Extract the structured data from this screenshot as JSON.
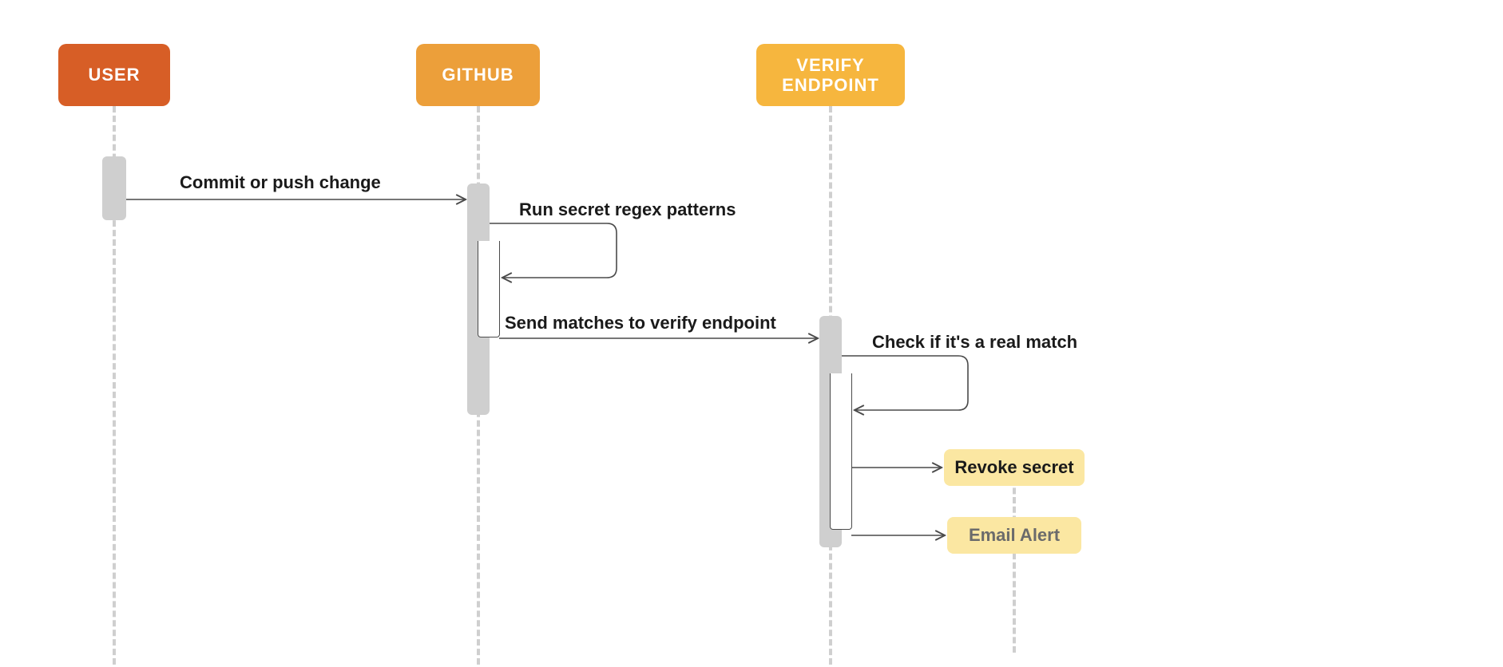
{
  "participants": {
    "user": {
      "label": "USER",
      "color": "#d75e26"
    },
    "github": {
      "label": "GITHUB",
      "color": "#ec9f3a"
    },
    "verify": {
      "label": "VERIFY ENDPOINT",
      "color": "#f6b63e"
    }
  },
  "messages": {
    "commit": "Commit or push change",
    "regex": "Run secret regex patterns",
    "send_matches": "Send matches to verify endpoint",
    "check_real": "Check if it's a real match"
  },
  "results": {
    "revoke": "Revoke secret",
    "email": "Email Alert"
  }
}
